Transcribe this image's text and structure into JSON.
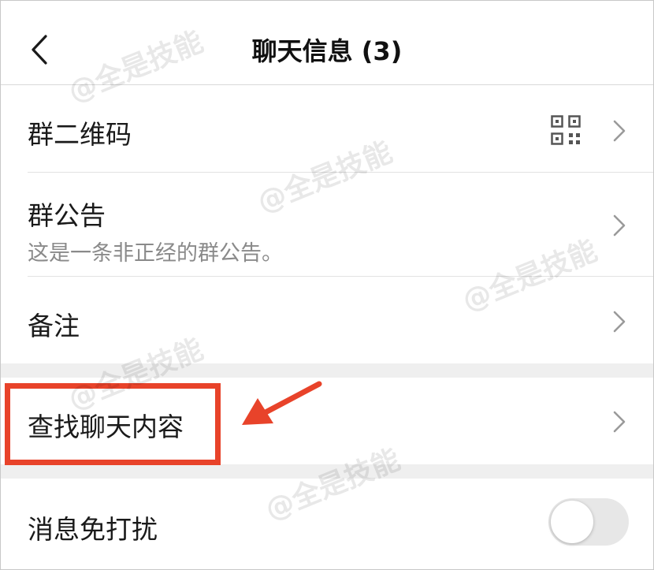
{
  "header": {
    "title": "聊天信息 (3)"
  },
  "rows": {
    "group_qr": {
      "label": "群二维码"
    },
    "group_notice": {
      "label": "群公告",
      "subtitle": "这是一条非正经的群公告。"
    },
    "remark": {
      "label": "备注"
    },
    "search_chat": {
      "label": "查找聊天内容"
    },
    "mute": {
      "label": "消息免打扰",
      "toggle_on": false
    }
  },
  "watermark": "@全是技能",
  "colors": {
    "highlight": "#e8432a",
    "separator_band": "#efefef",
    "subtitle_text": "#8a8a8a",
    "toggle_off": "#e7e7e7"
  }
}
